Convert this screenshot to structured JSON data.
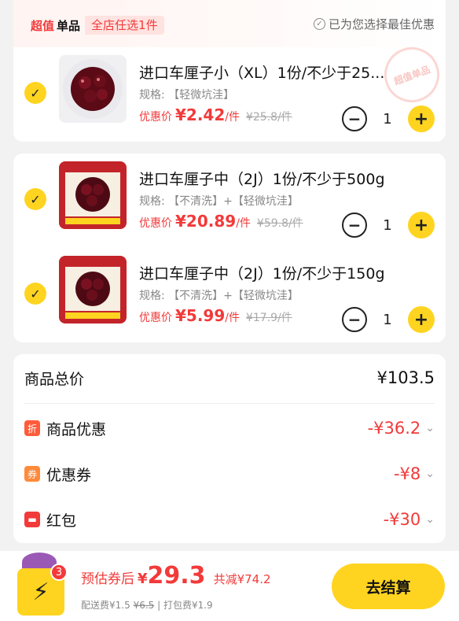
{
  "header": {
    "tag_part1": "超值",
    "tag_part2": "单品",
    "tag_part3": "全店任选1件",
    "best_offer": "已为您选择最佳优惠",
    "watermark": "超值单品"
  },
  "items": [
    {
      "title": "进口车厘子小（XL）1份/不少于25...",
      "spec": "规格: 【轻微坑洼】",
      "price_label": "优惠价",
      "price": "¥2.42",
      "unit": "/件",
      "original": "¥25.8/件",
      "qty": "1"
    },
    {
      "title": "进口车厘子中（2J）1份/不少于500g",
      "spec": "规格: 【不清洗】+【轻微坑洼】",
      "price_label": "优惠价",
      "price": "¥20.89",
      "unit": "/件",
      "original": "¥59.8/件",
      "qty": "1"
    },
    {
      "title": "进口车厘子中（2J）1份/不少于150g",
      "spec": "规格: 【不清洗】+【轻微坑洼】",
      "price_label": "优惠价",
      "price": "¥5.99",
      "unit": "/件",
      "original": "¥17.9/件",
      "qty": "1"
    }
  ],
  "summary": {
    "total_label": "商品总价",
    "total_value": "¥103.5",
    "discount_icon": "折",
    "discount_label": "商品优惠",
    "discount_value": "-¥36.2",
    "coupon_icon": "券",
    "coupon_label": "优惠券",
    "coupon_value": "-¥8",
    "redpacket_label": "红包",
    "redpacket_value": "-¥30"
  },
  "bottom": {
    "cart_count": "3",
    "after_coupon_label": "预估券后",
    "currency": "¥",
    "final_price": "29.3",
    "saved": "共减¥74.2",
    "delivery_label": "配送费¥1.5",
    "delivery_original": "¥6.5",
    "packing": "| 打包费¥1.9",
    "checkout": "去结算"
  },
  "colors": {
    "accent_yellow": "#ffd420",
    "price_red": "#f23a3a"
  }
}
